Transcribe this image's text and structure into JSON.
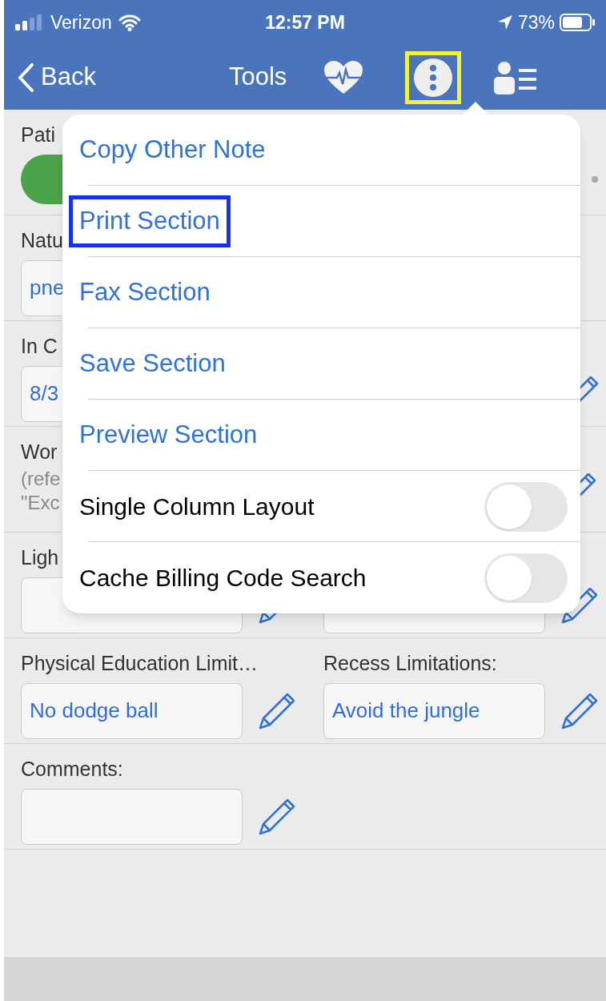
{
  "status_bar": {
    "carrier": "Verizon",
    "time": "12:57 PM",
    "battery": "73%"
  },
  "nav": {
    "back": "Back",
    "title": "Tools",
    "menu_highlighted": true
  },
  "rows": [
    {
      "kind": "toggle",
      "label": "Pati",
      "on": true
    },
    {
      "kind": "field",
      "label": "Natu",
      "value": "pne",
      "edit": false
    },
    {
      "kind": "field",
      "label": "In C",
      "value": "8/3",
      "edit": true
    },
    {
      "kind": "note",
      "label": "Wor",
      "lines": [
        "(refe",
        "\"Exc"
      ]
    },
    {
      "kind": "blank_pair",
      "label": "Ligh"
    },
    {
      "kind": "pair",
      "fields": [
        {
          "label": "Physical Education Limit…",
          "value": "No dodge ball"
        },
        {
          "label": "Recess Limitations:",
          "value": "Avoid the jungle"
        }
      ]
    },
    {
      "kind": "single",
      "label": "Comments:"
    }
  ],
  "menu": [
    {
      "kind": "action",
      "label": "Copy Other Note",
      "highlighted": false
    },
    {
      "kind": "action",
      "label": "Print Section",
      "highlighted": true
    },
    {
      "kind": "action",
      "label": "Fax Section",
      "highlighted": false
    },
    {
      "kind": "action",
      "label": "Save Section",
      "highlighted": false
    },
    {
      "kind": "action",
      "label": "Preview Section",
      "highlighted": false
    },
    {
      "kind": "switch",
      "label": "Single Column Layout",
      "on": false
    },
    {
      "kind": "switch",
      "label": "Cache Billing Code Search",
      "on": false
    }
  ]
}
